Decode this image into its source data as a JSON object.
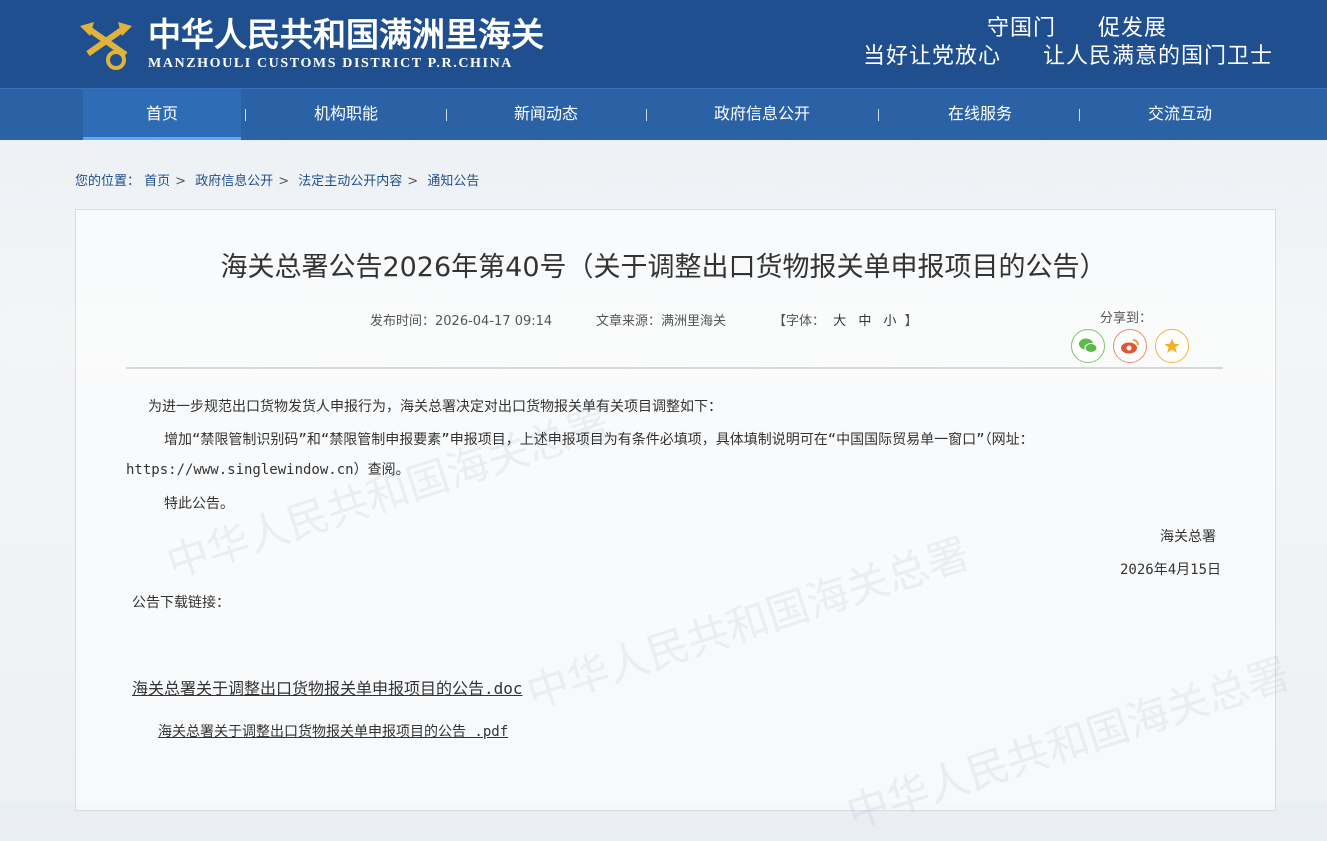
{
  "header": {
    "site_name_cn": "中华人民共和国满洲里海关",
    "site_name_en": "MANZHOULI CUSTOMS DISTRICT P.R.CHINA",
    "slogan_line1": [
      "守国门",
      "促发展"
    ],
    "slogan_line2": [
      "当好让党放心",
      "让人民满意的国门卫士"
    ],
    "logo_icon": "customs-emblem-icon",
    "colors": {
      "header_bg": "#1f4f8e",
      "nav_bg": "#2b62a6"
    }
  },
  "nav": {
    "items": [
      {
        "label": "首页",
        "active": true
      },
      {
        "label": "机构职能"
      },
      {
        "label": "新闻动态"
      },
      {
        "label": "政府信息公开"
      },
      {
        "label": "在线服务"
      },
      {
        "label": "交流互动"
      }
    ],
    "separator": "|"
  },
  "breadcrumb": {
    "prefix": "您的位置：",
    "items": [
      "首页",
      "政府信息公开",
      "法定主动公开内容",
      "通知公告"
    ],
    "separator": ">"
  },
  "article": {
    "title": "海关总署公告2026年第40号（关于调整出口货物报关单申报项目的公告）",
    "publish_label": "发布时间：",
    "publish_time": "2026-04-17 09:14",
    "source_label": "文章来源：",
    "source": "满洲里海关",
    "font_label_open": "【字体：",
    "font_sizes": [
      "大",
      "中",
      "小"
    ],
    "font_label_close": "】",
    "share_label": "分享到：",
    "share_icons": [
      "wechat-icon",
      "weibo-icon",
      "favorite-star-icon"
    ],
    "paragraphs": [
      "为进一步规范出口货物发货人申报行为，海关总署决定对出口货物报关单有关项目调整如下：",
      "增加“禁限管制识别码”和“禁限管制申报要素”申报项目，上述申报项目为有条件必填项，具体填制说明可在“中国国际贸易单一窗口”（网址：",
      "https://www.singlewindow.cn）查阅。",
      "特此公告。"
    ],
    "signature": "海关总署",
    "date": "2026年4月15日",
    "download_label": "公告下载链接：",
    "attachments": [
      "海关总署关于调整出口货物报关单申报项目的公告.doc",
      "海关总署关于调整出口货物报关单申报项目的公告 .pdf"
    ]
  }
}
